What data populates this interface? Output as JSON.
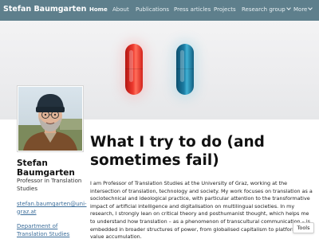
{
  "brand": {
    "name": "Stefan Baumgarten"
  },
  "nav": {
    "home": "Home",
    "about": "About",
    "publications": "Publications",
    "press": "Press articles",
    "projects": "Projects",
    "research_group": "Research group",
    "more": "More"
  },
  "profile": {
    "name_line1": "Stefan",
    "name_line2": "Baumgarten",
    "role": "Professor in Translation Studies",
    "email": "stefan.baumgarten@uni-graz.at",
    "department": "Department of Translation Studies"
  },
  "main": {
    "title": "What I try to do (and sometimes fail)",
    "intro": "I am Professor of Translation Studies at the University of Graz, working at the intersection of translation, technology and society. My work focuses on translation as a sociotechnical and ideological practice, with particular attention to the transformative impact of artificial intelligence and digitalisation on multilingual societies. In my research, I strongly lean on critical theory and posthumanist thought, which helps me to understand how translation – as a phenomenon of transcultural communication – is embedded in broader structures of power, from globalised capitalism to platform-based value accumulation."
  },
  "tools": {
    "label": "Tools"
  },
  "colors": {
    "navbar": "#5e7f8c",
    "link": "#3b6d9a",
    "pill_red": "#ee3a2f",
    "pill_blue": "#1c7da3"
  }
}
